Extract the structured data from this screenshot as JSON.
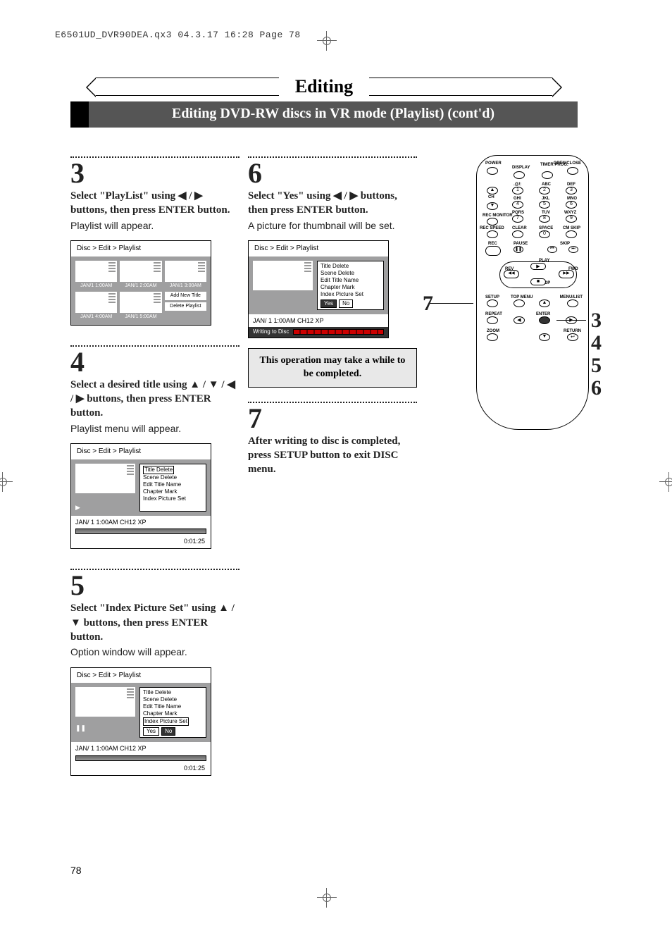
{
  "meta": {
    "header": "E6501UD_DVR90DEA.qx3  04.3.17  16:28  Page 78"
  },
  "title": "Editing",
  "subtitle": "Editing DVD-RW discs in VR mode (Playlist) (cont'd)",
  "steps": {
    "s3": {
      "num": "3",
      "head": "Select \"PlayList\" using ◀ / ▶ buttons, then press ENTER button.",
      "body": "Playlist will appear."
    },
    "s4": {
      "num": "4",
      "head": "Select a desired title using ▲ / ▼ / ◀ / ▶ buttons, then press ENTER button.",
      "body": "Playlist menu will appear."
    },
    "s5": {
      "num": "5",
      "head": "Select \"Index Picture Set\" using ▲ / ▼ buttons, then press ENTER button.",
      "body": "Option window will appear."
    },
    "s6": {
      "num": "6",
      "head": "Select \"Yes\" using ◀ / ▶ buttons, then press ENTER button.",
      "body": "A picture for thumbnail will be set."
    },
    "s7": {
      "num": "7",
      "head": "After writing to disc is completed, press SETUP button to exit DISC menu."
    }
  },
  "warn": "This operation may take a while to be completed.",
  "osd": {
    "crumb": "Disc > Edit > Playlist",
    "caps": [
      "JAN/1  1:00AM",
      "JAN/1  2:00AM",
      "JAN/1  3:00AM",
      "JAN/1  4:00AM",
      "JAN/1  5:00AM"
    ],
    "side_add": "Add New Title",
    "side_del": "Delete Playlist",
    "menu": [
      "Title Delete",
      "Scene Delete",
      "Edit Title Name",
      "Chapter Mark",
      "Index Picture Set"
    ],
    "yes": "Yes",
    "no": "No",
    "status1": "JAN/ 1   1:00AM  CH12     XP",
    "time": "0:01:25",
    "writing": "Writing to Disc"
  },
  "remote": {
    "labels": {
      "power": "POWER",
      "openclose": "OPEN/CLOSE",
      "display": "DISPLAY",
      "timer": "TIMER PROG.",
      "sym1": ".@/:",
      "abc": "ABC",
      "def": "DEF",
      "ch": "CH",
      "ghi": "GHI",
      "jkl": "JKL",
      "mno": "MNO",
      "recmon": "REC MONITOR",
      "pqrs": "PQRS",
      "tuv": "TUV",
      "wxyz": "WXYZ",
      "recspeed": "REC SPEED",
      "clear": "CLEAR",
      "space": "SPACE",
      "cmskip": "CM SKIP",
      "rec": "REC",
      "pause": "PAUSE",
      "skip": "SKIP",
      "play": "PLAY",
      "rev": "REV",
      "fwd": "FWD",
      "stop": "STOP",
      "setup": "SETUP",
      "topmenu": "TOP MENU",
      "menulist": "MENU/LIST",
      "repeat": "REPEAT",
      "enter": "ENTER",
      "return": "RETURN",
      "zoom": "ZOOM"
    },
    "nums": [
      "1",
      "2",
      "3",
      "4",
      "5",
      "6",
      "7",
      "8",
      "9",
      "0"
    ]
  },
  "callouts": {
    "c7": "7",
    "c3": "3",
    "c4": "4",
    "c5": "5",
    "c6": "6"
  },
  "page": "78"
}
